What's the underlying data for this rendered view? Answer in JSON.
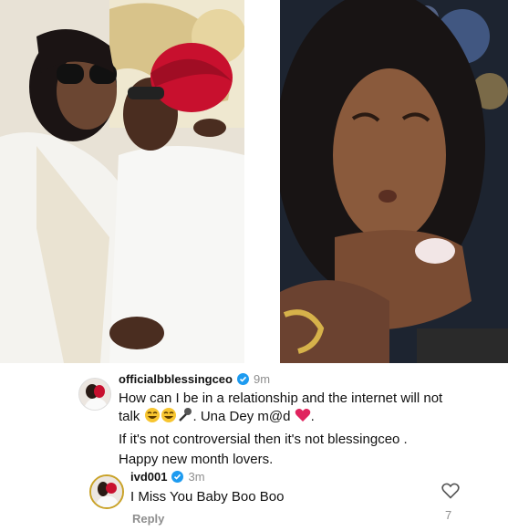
{
  "photos": {
    "left_alt": "couple photo",
    "right_alt": "woman photo"
  },
  "comments": [
    {
      "username": "officialbblessingceo",
      "time": "9m",
      "lines": [
        "How can I be in a relationship and the internet will not",
        "talk",
        ". Una Dey m@d",
        "If it's not controversial then it's not blessingceo .",
        "Happy new month lovers."
      ]
    },
    {
      "username": "ivd001",
      "time": "3m",
      "text": "I Miss You Baby Boo Boo",
      "likes": "7",
      "reply_label": "Reply"
    }
  ],
  "colors": {
    "verified": "#1d9bf0",
    "muted": "#8e8e8e",
    "heart": "#e0245e"
  },
  "icons": [
    "verified-badge-icon",
    "heart-outline-icon",
    "laughing-emoji-icon",
    "microphone-emoji-icon",
    "red-heart-emoji-icon"
  ]
}
